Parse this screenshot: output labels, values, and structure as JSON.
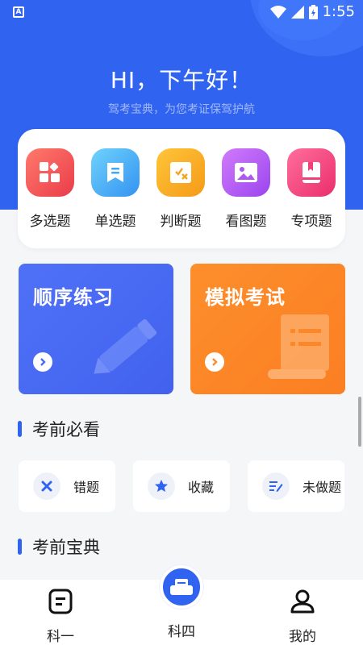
{
  "status_bar": {
    "time": "1:55"
  },
  "header": {
    "greeting": "HI，下午好！",
    "subtitle": "驾考宝典，为您考证保驾护航"
  },
  "categories": [
    {
      "label": "多选题",
      "icon": "grid-icon",
      "color": "#f05454"
    },
    {
      "label": "单选题",
      "icon": "bookmark-icon",
      "color": "#3da9f5"
    },
    {
      "label": "判断题",
      "icon": "percent-icon",
      "color": "#f5a623"
    },
    {
      "label": "看图题",
      "icon": "image-icon",
      "color": "#b057f2"
    },
    {
      "label": "专项题",
      "icon": "book-icon",
      "color": "#f03f7a"
    }
  ],
  "practice": {
    "sequential": {
      "title": "顺序练习",
      "color": "#4a6cf5"
    },
    "mock": {
      "title": "模拟考试",
      "color": "#fb8b2c"
    }
  },
  "sections": {
    "must_see": "考前必看",
    "handbook": "考前宝典"
  },
  "must_see_items": [
    {
      "label": "错题",
      "icon": "x-icon"
    },
    {
      "label": "收藏",
      "icon": "star-icon"
    },
    {
      "label": "未做题",
      "icon": "edit-list-icon"
    }
  ],
  "tabs": {
    "left": "科一",
    "center": "科四",
    "right": "我的"
  },
  "colors": {
    "primary": "#2f63f0",
    "background": "#f5f6f8"
  }
}
